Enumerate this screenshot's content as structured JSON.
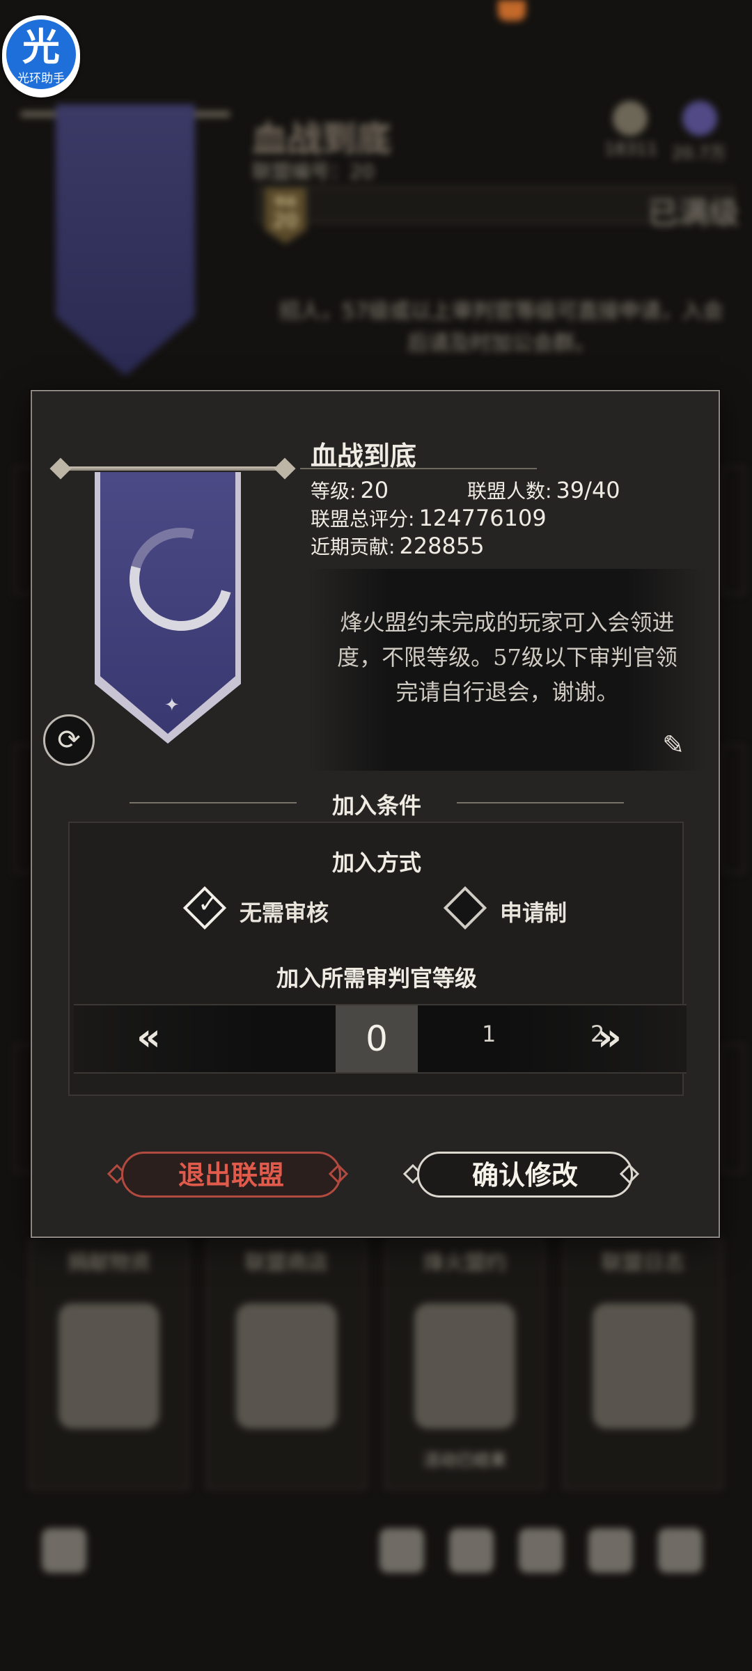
{
  "background": {
    "guild_name": "血战到底",
    "guild_id_label": "联盟编号：20",
    "resources": [
      "18311",
      "20.7万"
    ],
    "level_badge": "等级",
    "level_badge_value": "20",
    "status": "已满级",
    "notice": "招人，57级或以上审判官等级可直接申请，入会后请及时加公会群。",
    "cards": [
      {
        "title": "捐献物资",
        "footer": ""
      },
      {
        "title": "联盟商店",
        "footer": ""
      },
      {
        "title": "烽火盟约",
        "footer": "活动已结束"
      },
      {
        "title": "联盟日志",
        "footer": ""
      }
    ],
    "nav_icons": [
      "back-icon",
      "share-icon",
      "members-icon",
      "search-icon",
      "book-icon",
      "hall-icon"
    ]
  },
  "watermark": {
    "glyph": "光",
    "text": "光环助手",
    "color": "#1e6fd9"
  },
  "dialog": {
    "guild_name": "血战到底",
    "level_label": "等级:",
    "level_value": "20",
    "members_label": "联盟人数:",
    "members_value": "39/40",
    "score_label": "联盟总评分:",
    "score_value": "124776109",
    "contribution_label": "近期贡献:",
    "contribution_value": "228855",
    "notice": "烽火盟约未完成的玩家可入会领进度，不限等级。57级以下审判官领完请自行退会，谢谢。",
    "section_title": "加入条件",
    "join_mode_title": "加入方式",
    "options": [
      {
        "label": "无需审核",
        "checked": true
      },
      {
        "label": "申请制",
        "checked": false
      }
    ],
    "level_req_title": "加入所需审判官等级",
    "picker": {
      "selected": "0",
      "next": "1",
      "next2": "2"
    },
    "quit_button": "退出联盟",
    "confirm_button": "确认修改",
    "colors": {
      "quit": "#e05b4c",
      "confirm": "#f5f2ea"
    }
  }
}
